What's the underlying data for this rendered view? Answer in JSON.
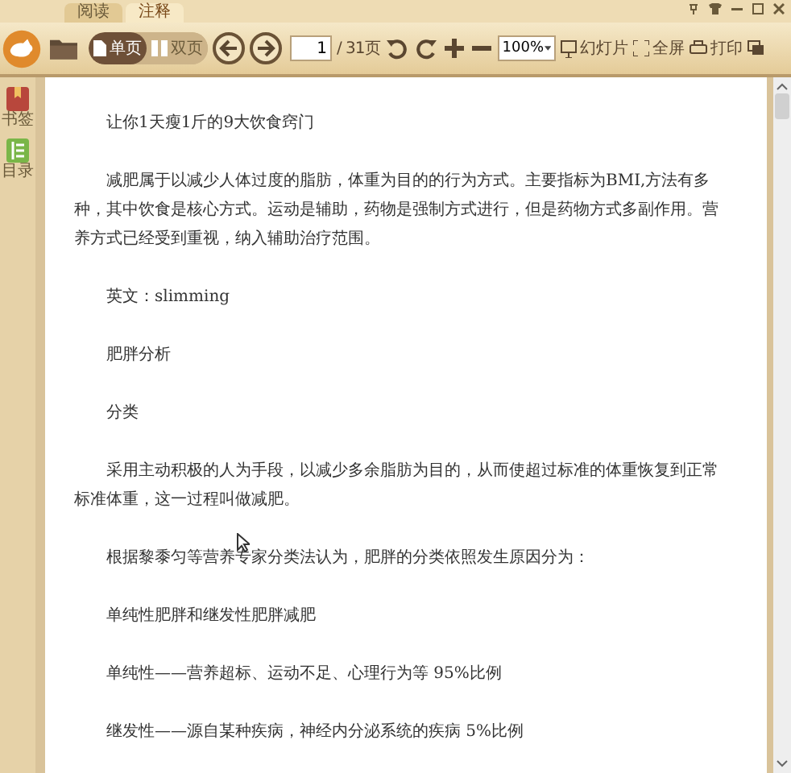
{
  "tabs": [
    {
      "label": "阅读",
      "selected": false
    },
    {
      "label": "注释",
      "selected": true
    }
  ],
  "toolbar": {
    "view_modes": [
      {
        "label": "单页",
        "kind": "single",
        "selected": true
      },
      {
        "label": "双页",
        "kind": "double",
        "selected": false
      }
    ],
    "page": {
      "value": "1",
      "total": "/ 31页"
    },
    "zoom": {
      "value": "100%"
    },
    "actions": [
      {
        "label": "幻灯片",
        "kind": "slideshow"
      },
      {
        "label": "全屏",
        "kind": "fullscreen"
      },
      {
        "label": "打印",
        "kind": "print"
      }
    ]
  },
  "sidebar": {
    "items": [
      {
        "label": "书签",
        "kind": "bookmark"
      },
      {
        "label": "目录",
        "kind": "toc"
      }
    ]
  },
  "document": {
    "paragraphs": [
      "让你1天瘦1斤的9大饮食窍门",
      "减肥属于以减少人体过度的脂肪，体重为目的的行为方式。主要指标为BMI,方法有多种，其中饮食是核心方式。运动是辅助，药物是强制方式进行，但是药物方式多副作用。营养方式已经受到重视，纳入辅助治疗范围。",
      "英文：slimming",
      "肥胖分析",
      "分类",
      "采用主动积极的人为手段，以减少多余脂肪为目的，从而使超过标准的体重恢复到正常标准体重，这一过程叫做减肥。",
      "根据黎黍匀等营养专家分类法认为，肥胖的分类依照发生原因分为：",
      "单纯性肥胖和继发性肥胖减肥",
      "单纯性——营养超标、运动不足、心理行为等 95%比例",
      "继发性——源自某种疾病，神经内分泌系统的疾病 5%比例"
    ]
  }
}
